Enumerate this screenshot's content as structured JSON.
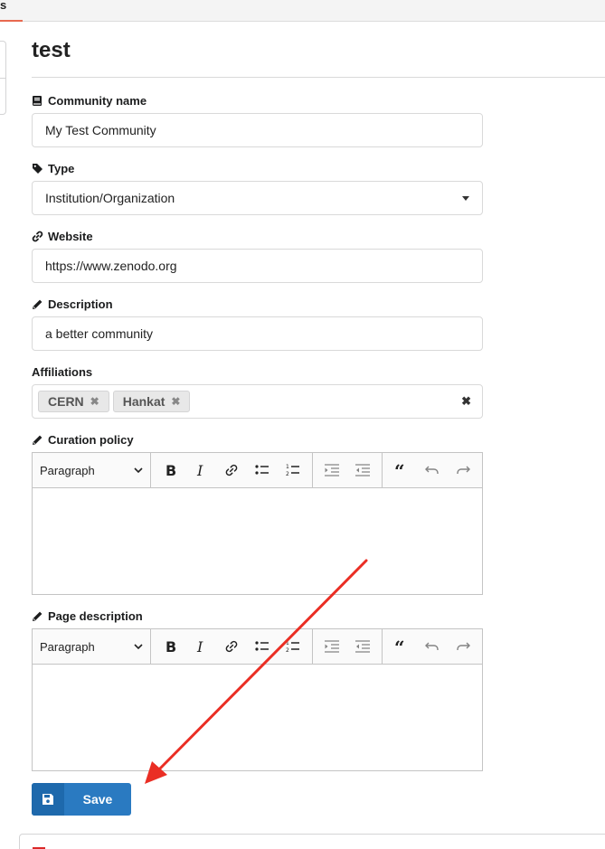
{
  "topbar": {
    "tab_fragment": "s"
  },
  "page": {
    "title": "test"
  },
  "fields": {
    "name": {
      "label": "Community name",
      "value": "My Test Community"
    },
    "type": {
      "label": "Type",
      "value": "Institution/Organization"
    },
    "website": {
      "label": "Website",
      "value": "https://www.zenodo.org"
    },
    "description": {
      "label": "Description",
      "value": "a better community"
    },
    "affiliations": {
      "label": "Affiliations",
      "chips": [
        "CERN",
        "Hankat"
      ]
    },
    "curation": {
      "label": "Curation policy",
      "format": "Paragraph"
    },
    "page_description": {
      "label": "Page description",
      "format": "Paragraph"
    }
  },
  "actions": {
    "save_label": "Save"
  },
  "colors": {
    "primary": "#2a7ac1",
    "annotation_arrow": "#ea2e24",
    "tab_accent": "#e8694f"
  },
  "icons": [
    "book-icon",
    "tag-icon",
    "link-icon",
    "pencil-icon",
    "save-icon",
    "bold-icon",
    "italic-icon",
    "link-icon",
    "bulleted-list-icon",
    "numbered-list-icon",
    "outdent-icon",
    "indent-icon",
    "blockquote-icon",
    "undo-icon",
    "redo-icon"
  ]
}
